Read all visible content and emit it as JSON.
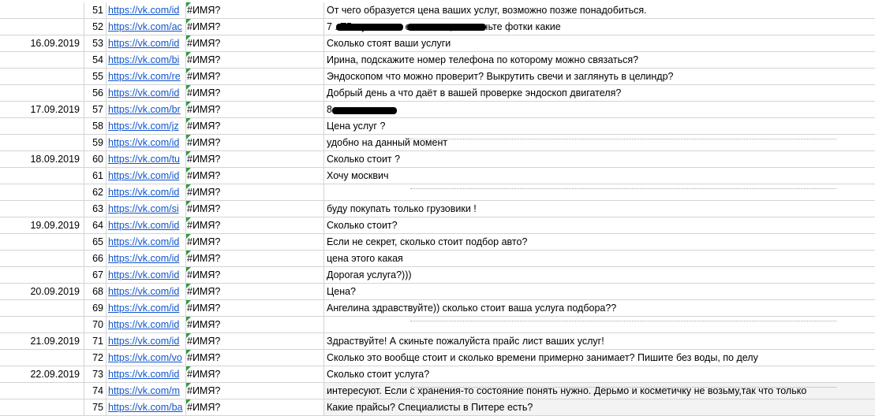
{
  "rows": [
    {
      "date": "",
      "num": "51",
      "link": "https://vk.com/id",
      "name": "#ИМЯ?",
      "message": "От чего образуется цена ваших услуг, возможно позже понадобиться."
    },
    {
      "date": "",
      "num": "52",
      "link": "https://vk.com/ac",
      "name": "#ИМЯ?",
      "message": "7                                        . Т5 мультиван если есть, то скиньте фотки какие"
    },
    {
      "date": "16.09.2019",
      "num": "53",
      "link": "https://vk.com/id",
      "name": "#ИМЯ?",
      "message": "Сколько стоят ваши услуги"
    },
    {
      "date": "",
      "num": "54",
      "link": "https://vk.com/bi",
      "name": "#ИМЯ?",
      "message": "Ирина, подскажите номер телефона по которому можно связаться?"
    },
    {
      "date": "",
      "num": "55",
      "link": "https://vk.com/re",
      "name": "#ИМЯ?",
      "message": "Эндоскопом что можно проверит? Выкрутить свечи и заглянуть в целиндр?"
    },
    {
      "date": "",
      "num": "56",
      "link": "https://vk.com/id",
      "name": "#ИМЯ?",
      "message": "Добрый день а что даёт в вашей проверке эндоскоп двигателя?"
    },
    {
      "date": "17.09.2019",
      "num": "57",
      "link": "https://vk.com/br",
      "name": "#ИМЯ?",
      "message": "8"
    },
    {
      "date": "",
      "num": "58",
      "link": "https://vk.com/jz",
      "name": "#ИМЯ?",
      "message": "Цена услуг ?"
    },
    {
      "date": "",
      "num": "59",
      "link": "https://vk.com/id",
      "name": "#ИМЯ?",
      "message": "удобно на данный момент"
    },
    {
      "date": "18.09.2019",
      "num": "60",
      "link": "https://vk.com/tu",
      "name": "#ИМЯ?",
      "message": "Сколько стоит ?"
    },
    {
      "date": "",
      "num": "61",
      "link": "https://vk.com/id",
      "name": "#ИМЯ?",
      "message": "Хочу москвич"
    },
    {
      "date": "",
      "num": "62",
      "link": "https://vk.com/id",
      "name": "#ИМЯ?",
      "message": ""
    },
    {
      "date": "",
      "num": "63",
      "link": "https://vk.com/si",
      "name": "#ИМЯ?",
      "message": "буду покупать только грузовики !"
    },
    {
      "date": "19.09.2019",
      "num": "64",
      "link": "https://vk.com/id",
      "name": "#ИМЯ?",
      "message": "Сколько стоит?"
    },
    {
      "date": "",
      "num": "65",
      "link": "https://vk.com/id",
      "name": "#ИМЯ?",
      "message": "Если не секрет, сколько стоит подбор авто?"
    },
    {
      "date": "",
      "num": "66",
      "link": "https://vk.com/id",
      "name": "#ИМЯ?",
      "message": "цена этого какая"
    },
    {
      "date": "",
      "num": "67",
      "link": "https://vk.com/id",
      "name": "#ИМЯ?",
      "message": "Дорогая услуга?)))"
    },
    {
      "date": "20.09.2019",
      "num": "68",
      "link": "https://vk.com/id",
      "name": "#ИМЯ?",
      "message": "Цена?"
    },
    {
      "date": "",
      "num": "69",
      "link": "https://vk.com/id",
      "name": "#ИМЯ?",
      "message": "Ангелина здравствуйте)) сколько стоит ваша услуга подбора??"
    },
    {
      "date": "",
      "num": "70",
      "link": "https://vk.com/id",
      "name": "#ИМЯ?",
      "message": ""
    },
    {
      "date": "21.09.2019",
      "num": "71",
      "link": "https://vk.com/id",
      "name": "#ИМЯ?",
      "message": "Здраствуйте! А скиньте пожалуйста прайс лист ваших услуг!"
    },
    {
      "date": "",
      "num": "72",
      "link": "https://vk.com/vo",
      "name": "#ИМЯ?",
      "message": "Сколько это вообще стоит и сколько времени примерно занимает? Пишите без воды, по делу"
    },
    {
      "date": "22.09.2019",
      "num": "73",
      "link": "https://vk.com/id",
      "name": "#ИМЯ?",
      "message": "Сколько стоит услуга?"
    },
    {
      "date": "",
      "num": "74",
      "link": "https://vk.com/m",
      "name": "#ИМЯ?",
      "message": "интересуют. Если с хранения-то состояние понять нужно. Дерьмо и косметичку не возьму,так что только"
    },
    {
      "date": "",
      "num": "75",
      "link": "https://vk.com/ba",
      "name": "#ИМЯ?",
      "message": "Какие прайсы? Специалисты в Питере есть?"
    }
  ],
  "colors": {
    "link": "#1155cc",
    "note_marker": "#2e9b3f",
    "grid": "#d4d4d4"
  }
}
